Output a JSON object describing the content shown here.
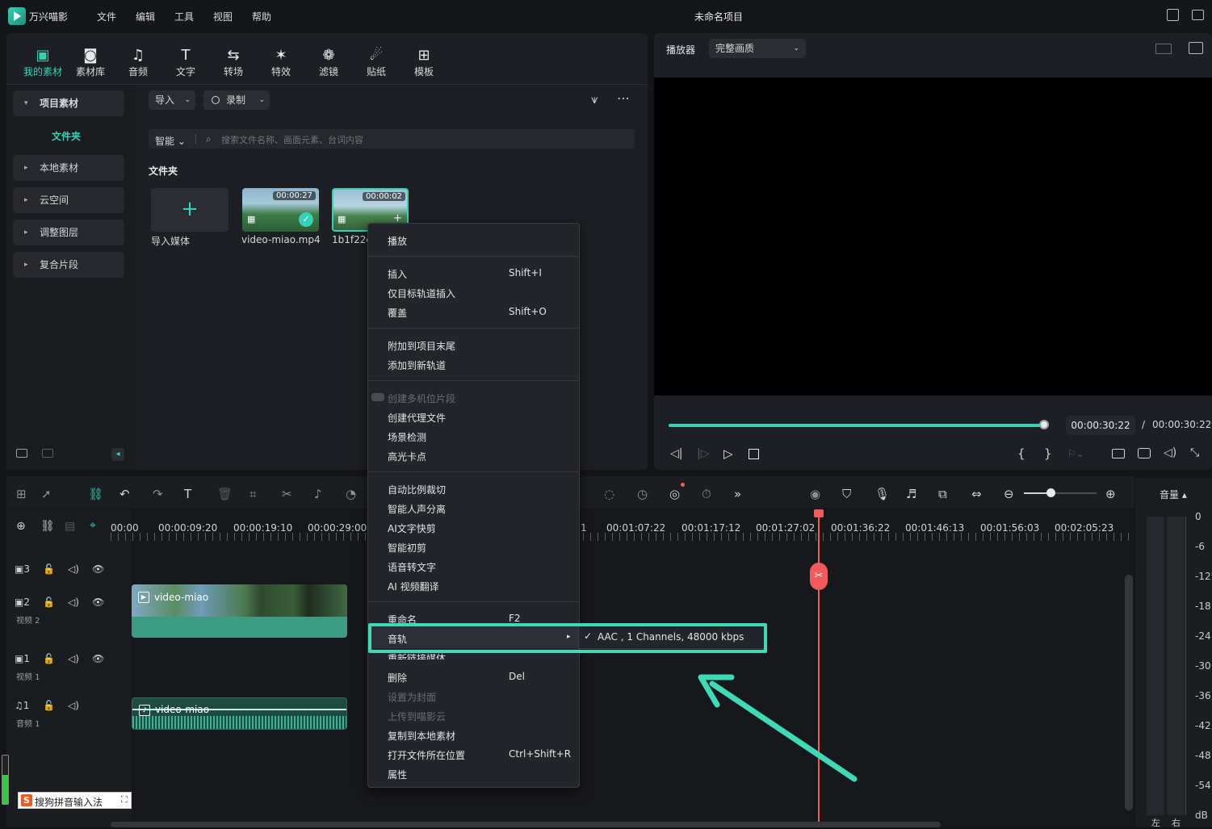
{
  "app": {
    "name": "万兴喵影",
    "project_title": "未命名项目"
  },
  "menu": [
    "文件",
    "编辑",
    "工具",
    "视图",
    "帮助"
  ],
  "media_toolbar": [
    {
      "label": "我的素材",
      "icon": "media-icon",
      "active": true
    },
    {
      "label": "素材库",
      "icon": "library-icon"
    },
    {
      "label": "音频",
      "icon": "music-note-icon"
    },
    {
      "label": "文字",
      "icon": "text-icon"
    },
    {
      "label": "转场",
      "icon": "transition-icon"
    },
    {
      "label": "特效",
      "icon": "effects-icon"
    },
    {
      "label": "滤镜",
      "icon": "filter-icon"
    },
    {
      "label": "贴纸",
      "icon": "sticker-icon"
    },
    {
      "label": "模板",
      "icon": "template-icon"
    }
  ],
  "sidebar": {
    "project_media": "项目素材",
    "folder": "文件夹",
    "items": [
      "本地素材",
      "云空间",
      "调整图层",
      "复合片段"
    ]
  },
  "media": {
    "import": "导入",
    "record": "录制",
    "smart": "智能",
    "search_placeholder": "搜索文件名称、画面元素、台词内容",
    "folder_title": "文件夹",
    "import_media": "导入媒体",
    "clips": [
      {
        "name": "video-miao.mp4",
        "duration": "00:00:27"
      },
      {
        "name": "1b1f22c",
        "duration": "00:00:02"
      }
    ]
  },
  "player": {
    "label": "播放器",
    "quality": "完整画质",
    "current_time": "00:00:30:22",
    "separator": "/",
    "total_time": "00:00:30:22",
    "progress": 0.99
  },
  "context_menu": {
    "items": [
      {
        "label": "播放"
      },
      {
        "label": "插入",
        "shortcut": "Shift+I"
      },
      {
        "label": "仅目标轨道插入"
      },
      {
        "label": "覆盖",
        "shortcut": "Shift+O"
      },
      {
        "label": "附加到项目末尾"
      },
      {
        "label": "添加到新轨道"
      },
      {
        "label": "创建多机位片段",
        "disabled": true
      },
      {
        "label": "创建代理文件"
      },
      {
        "label": "场景检测"
      },
      {
        "label": "高光卡点"
      },
      {
        "label": "自动比例裁切"
      },
      {
        "label": "智能人声分离"
      },
      {
        "label": "AI文字快剪"
      },
      {
        "label": "智能初剪"
      },
      {
        "label": "语音转文字"
      },
      {
        "label": "AI 视频翻译"
      },
      {
        "label": "重命名",
        "shortcut": "F2"
      },
      {
        "label": "音轨"
      },
      {
        "label": "重新链接媒体"
      },
      {
        "label": "删除",
        "shortcut": "Del"
      },
      {
        "label": "设置为封面",
        "disabled": true
      },
      {
        "label": "上传到喵影云",
        "disabled": true
      },
      {
        "label": "复制到本地素材"
      },
      {
        "label": "打开文件所在位置",
        "shortcut": "Ctrl+Shift+R"
      },
      {
        "label": "属性"
      }
    ],
    "submenu": "AAC , 1 Channels, 48000 kbps"
  },
  "timeline": {
    "ruler": [
      "00:00",
      "00:00:09:20",
      "00:00:19:10",
      "00:00:29:00",
      "1",
      "00:01:07:22",
      "00:01:17:12",
      "00:01:27:02",
      "00:01:36:22",
      "00:01:46:13",
      "00:01:56:03",
      "00:02:05:23"
    ],
    "tracks": [
      {
        "num": "3",
        "name": ""
      },
      {
        "num": "2",
        "name": "视频 2"
      },
      {
        "num": "1",
        "name": "视频 1"
      },
      {
        "num": "1",
        "name": "音频 1"
      }
    ],
    "clips": {
      "video": "video-miao",
      "audio": "video-miao"
    }
  },
  "meter": {
    "label": "音量",
    "scale": [
      "0",
      "-6",
      "-12",
      "-18",
      "-24",
      "-30",
      "-36",
      "-42",
      "-48",
      "-54",
      "dB"
    ],
    "left": "左",
    "right": "右"
  },
  "ime": "搜狗拼音输入法",
  "colors": {
    "accent": "#35d3b5",
    "playhead": "#f15a5a",
    "highlight": "#3fd9b5"
  }
}
